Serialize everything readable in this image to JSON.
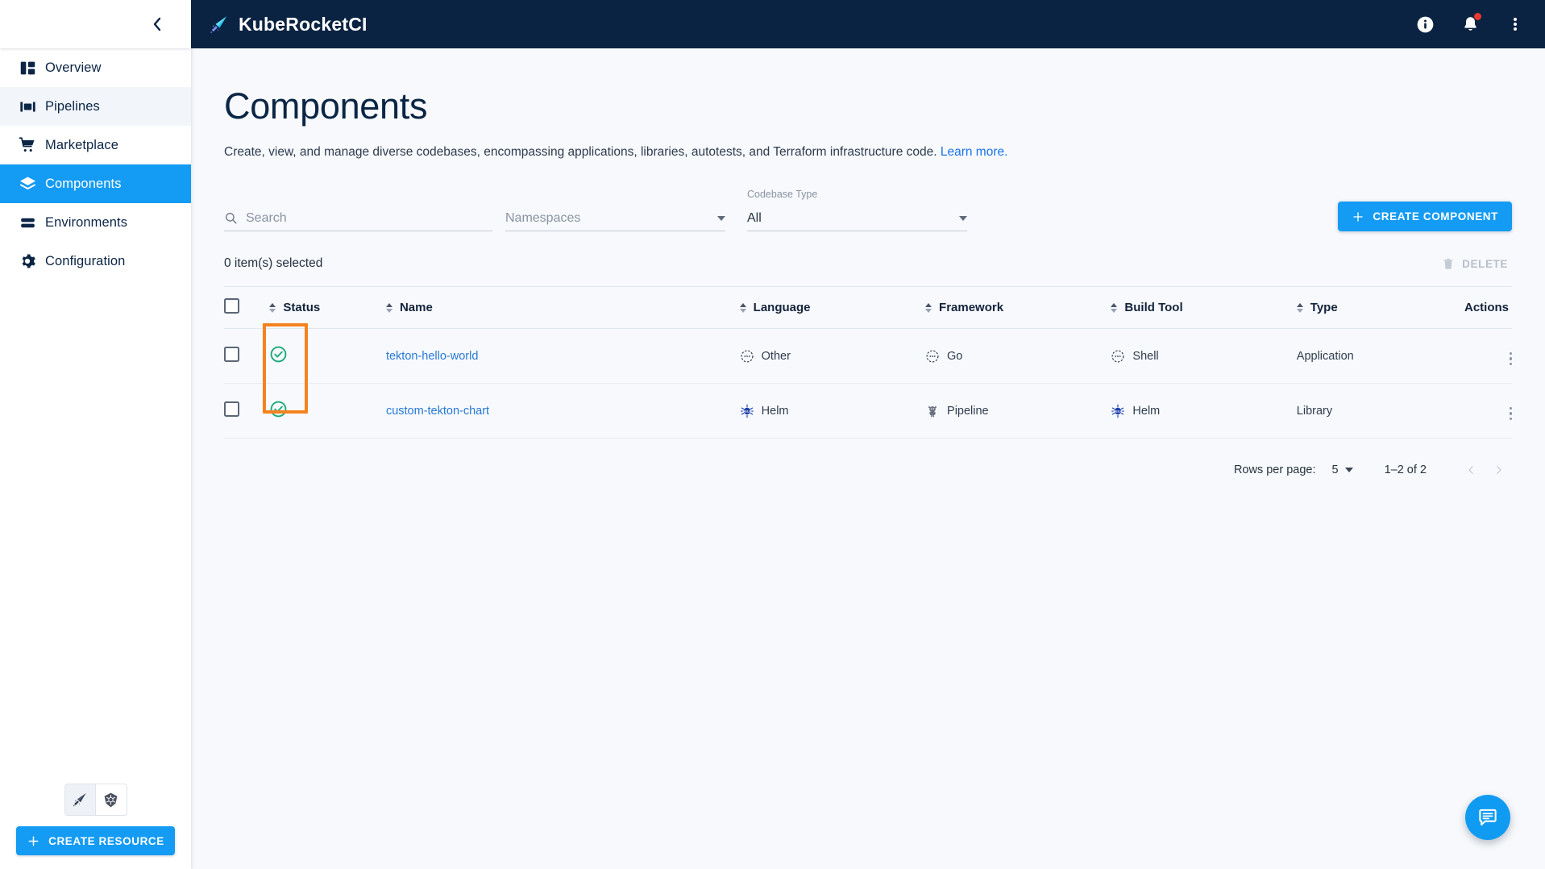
{
  "app": {
    "brand_name": "KubeRocketCI",
    "logo_icon": "rocket-quill-icon"
  },
  "topbar": {
    "info_icon": "info-circle-icon",
    "notifications_icon": "bell-icon",
    "has_notification_badge": true,
    "overflow_icon": "kebab-menu-icon"
  },
  "sidebar": {
    "collapse_icon": "chevron-left-icon",
    "items": [
      {
        "label": "Overview",
        "icon": "dashboard-layout-icon",
        "state": "default"
      },
      {
        "label": "Pipelines",
        "icon": "pipelines-icon",
        "state": "hover"
      },
      {
        "label": "Marketplace",
        "icon": "shopping-cart-icon",
        "state": "default"
      },
      {
        "label": "Components",
        "icon": "layers-icon",
        "state": "active"
      },
      {
        "label": "Environments",
        "icon": "stacked-bars-icon",
        "state": "default"
      },
      {
        "label": "Configuration",
        "icon": "gear-icon",
        "state": "default"
      }
    ],
    "view_toggle": [
      {
        "icon": "rocket-quill-icon",
        "selected": true
      },
      {
        "icon": "kubernetes-icon",
        "selected": false
      }
    ],
    "create_resource_label": "CREATE RESOURCE",
    "create_resource_icon": "plus-icon"
  },
  "page": {
    "title": "Components",
    "description": "Create, view, and manage diverse codebases, encompassing applications, libraries, autotests, and Terraform infrastructure code.",
    "learn_more_label": "Learn more."
  },
  "filters": {
    "search": {
      "placeholder": "Search",
      "value": "",
      "icon": "search-icon"
    },
    "namespaces": {
      "label": "",
      "placeholder": "Namespaces",
      "value": "",
      "icon": "chevron-down-icon"
    },
    "codebase_type": {
      "label": "Codebase Type",
      "value": "All",
      "icon": "chevron-down-icon"
    },
    "create_button_label": "CREATE COMPONENT",
    "create_button_icon": "plus-icon"
  },
  "selection": {
    "selected_text": "0 item(s) selected",
    "delete_label": "DELETE",
    "delete_icon": "trash-icon",
    "delete_disabled": true
  },
  "table": {
    "select_all_checked": false,
    "columns": [
      {
        "key": "check",
        "label": "",
        "sortable": false
      },
      {
        "key": "status",
        "label": "Status",
        "sortable": true
      },
      {
        "key": "name",
        "label": "Name",
        "sortable": true
      },
      {
        "key": "lang",
        "label": "Language",
        "sortable": true
      },
      {
        "key": "fw",
        "label": "Framework",
        "sortable": true
      },
      {
        "key": "bt",
        "label": "Build Tool",
        "sortable": true
      },
      {
        "key": "type",
        "label": "Type",
        "sortable": true
      },
      {
        "key": "actions",
        "label": "Actions",
        "sortable": false
      }
    ],
    "rows": [
      {
        "checked": false,
        "status_icon": "check-circle-icon",
        "status_color": "#1cab78",
        "name": "tekton-hello-world",
        "language": {
          "text": "Other",
          "icon": "dotted-circle-icon"
        },
        "framework": {
          "text": "Go",
          "icon": "dotted-circle-icon"
        },
        "build_tool": {
          "text": "Shell",
          "icon": "dotted-circle-icon"
        },
        "type": "Application",
        "actions_icon": "kebab-menu-icon"
      },
      {
        "checked": false,
        "status_icon": "check-circle-icon",
        "status_color": "#1cab78",
        "name": "custom-tekton-chart",
        "language": {
          "text": "Helm",
          "icon": "helm-icon"
        },
        "framework": {
          "text": "Pipeline",
          "icon": "tekton-icon"
        },
        "build_tool": {
          "text": "Helm",
          "icon": "helm-icon"
        },
        "type": "Library",
        "actions_icon": "kebab-menu-icon"
      }
    ]
  },
  "highlight": {
    "target": "status-column-cells",
    "color": "#f58220"
  },
  "pagination": {
    "rows_per_page_label": "Rows per page:",
    "rows_per_page_value": "5",
    "range_label": "1–2 of 2",
    "prev_icon": "chevron-left-icon",
    "next_icon": "chevron-right-icon"
  },
  "fab": {
    "icon": "chat-bubble-icon",
    "color": "#109bf2"
  },
  "colors": {
    "accent": "#149bf3",
    "navy": "#0a2342",
    "success": "#1cab78",
    "highlight": "#f58220",
    "link": "#2779d6"
  }
}
